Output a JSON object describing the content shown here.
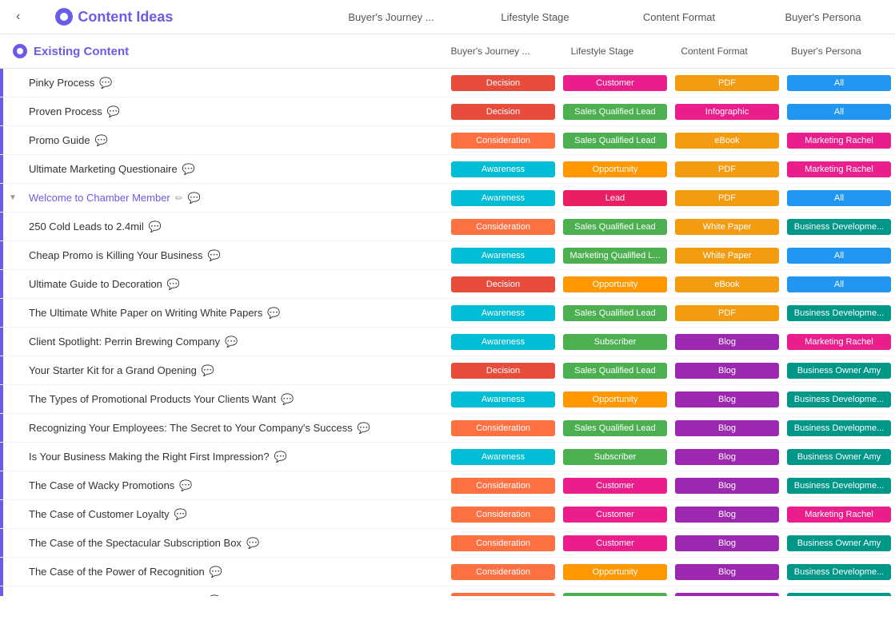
{
  "app": {
    "title": "Content Ideas",
    "back_arrow": "‹"
  },
  "nav": {
    "logo_text": "Content Ideas",
    "columns": [
      {
        "label": "Buyer's Journey ..."
      },
      {
        "label": "Lifestyle Stage"
      },
      {
        "label": "Content Format"
      },
      {
        "label": "Buyer's Persona"
      }
    ]
  },
  "section": {
    "title": "Existing Content",
    "col_headers": [
      {
        "label": "Buyer's Journey ..."
      },
      {
        "label": "Lifestyle Stage"
      },
      {
        "label": "Content Format"
      },
      {
        "label": "Buyer's Persona"
      }
    ]
  },
  "rows": [
    {
      "title": "Pinky Process",
      "is_link": false,
      "has_edit": false,
      "toggle": "",
      "cells": [
        {
          "text": "Decision",
          "color": "#e74c3c"
        },
        {
          "text": "Customer",
          "color": "#e91e8c"
        },
        {
          "text": "PDF",
          "color": "#f39c12"
        },
        {
          "text": "All",
          "color": "#2196f3"
        }
      ]
    },
    {
      "title": "Proven Process",
      "is_link": false,
      "has_edit": false,
      "toggle": "",
      "cells": [
        {
          "text": "Decision",
          "color": "#e74c3c"
        },
        {
          "text": "Sales Qualified Lead",
          "color": "#4caf50"
        },
        {
          "text": "Infographic",
          "color": "#e91e8c"
        },
        {
          "text": "All",
          "color": "#2196f3"
        }
      ]
    },
    {
      "title": "Promo Guide",
      "is_link": false,
      "has_edit": false,
      "toggle": "",
      "cells": [
        {
          "text": "Consideration",
          "color": "#ff7043"
        },
        {
          "text": "Sales Qualified Lead",
          "color": "#4caf50"
        },
        {
          "text": "eBook",
          "color": "#f39c12"
        },
        {
          "text": "Marketing Rachel",
          "color": "#e91e8c"
        }
      ]
    },
    {
      "title": "Ultimate Marketing Questionaire",
      "is_link": false,
      "has_edit": false,
      "toggle": "",
      "cells": [
        {
          "text": "Awareness",
          "color": "#00bcd4"
        },
        {
          "text": "Opportunity",
          "color": "#ff9800"
        },
        {
          "text": "PDF",
          "color": "#f39c12"
        },
        {
          "text": "Marketing Rachel",
          "color": "#e91e8c"
        }
      ]
    },
    {
      "title": "Welcome to Chamber Member",
      "is_link": true,
      "has_edit": true,
      "toggle": "▼",
      "cells": [
        {
          "text": "Awareness",
          "color": "#00bcd4"
        },
        {
          "text": "Lead",
          "color": "#e91e63"
        },
        {
          "text": "PDF",
          "color": "#f39c12"
        },
        {
          "text": "All",
          "color": "#2196f3"
        }
      ]
    },
    {
      "title": "250 Cold Leads to 2.4mil",
      "is_link": false,
      "has_edit": false,
      "toggle": "",
      "cells": [
        {
          "text": "Consideration",
          "color": "#ff7043"
        },
        {
          "text": "Sales Qualified Lead",
          "color": "#4caf50"
        },
        {
          "text": "White Paper",
          "color": "#f39c12"
        },
        {
          "text": "Business Developme...",
          "color": "#009688"
        }
      ]
    },
    {
      "title": "Cheap Promo is Killing Your Business",
      "is_link": false,
      "has_edit": false,
      "toggle": "",
      "cells": [
        {
          "text": "Awareness",
          "color": "#00bcd4"
        },
        {
          "text": "Marketing Qualified L...",
          "color": "#4caf50"
        },
        {
          "text": "White Paper",
          "color": "#f39c12"
        },
        {
          "text": "All",
          "color": "#2196f3"
        }
      ]
    },
    {
      "title": "Ultimate Guide to Decoration",
      "is_link": false,
      "has_edit": false,
      "toggle": "",
      "cells": [
        {
          "text": "Decision",
          "color": "#e74c3c"
        },
        {
          "text": "Opportunity",
          "color": "#ff9800"
        },
        {
          "text": "eBook",
          "color": "#f39c12"
        },
        {
          "text": "All",
          "color": "#2196f3"
        }
      ]
    },
    {
      "title": "The Ultimate White Paper on Writing White Papers",
      "is_link": false,
      "has_edit": false,
      "toggle": "",
      "cells": [
        {
          "text": "Awareness",
          "color": "#00bcd4"
        },
        {
          "text": "Sales Qualified Lead",
          "color": "#4caf50"
        },
        {
          "text": "PDF",
          "color": "#f39c12"
        },
        {
          "text": "Business Developme...",
          "color": "#009688"
        }
      ]
    },
    {
      "title": "Client Spotlight: Perrin Brewing Company",
      "is_link": false,
      "has_edit": false,
      "toggle": "",
      "cells": [
        {
          "text": "Awareness",
          "color": "#00bcd4"
        },
        {
          "text": "Subscriber",
          "color": "#4caf50"
        },
        {
          "text": "Blog",
          "color": "#9c27b0"
        },
        {
          "text": "Marketing Rachel",
          "color": "#e91e8c"
        }
      ]
    },
    {
      "title": "Your Starter Kit for a Grand Opening",
      "is_link": false,
      "has_edit": false,
      "toggle": "",
      "cells": [
        {
          "text": "Decision",
          "color": "#e74c3c"
        },
        {
          "text": "Sales Qualified Lead",
          "color": "#4caf50"
        },
        {
          "text": "Blog",
          "color": "#9c27b0"
        },
        {
          "text": "Business Owner Amy",
          "color": "#009688"
        }
      ]
    },
    {
      "title": "The Types of Promotional Products Your Clients Want",
      "is_link": false,
      "has_edit": false,
      "toggle": "",
      "cells": [
        {
          "text": "Awareness",
          "color": "#00bcd4"
        },
        {
          "text": "Opportunity",
          "color": "#ff9800"
        },
        {
          "text": "Blog",
          "color": "#9c27b0"
        },
        {
          "text": "Business Developme...",
          "color": "#009688"
        }
      ]
    },
    {
      "title": "Recognizing Your Employees: The Secret to Your Company's Success",
      "is_link": false,
      "has_edit": false,
      "toggle": "",
      "cells": [
        {
          "text": "Consideration",
          "color": "#ff7043"
        },
        {
          "text": "Sales Qualified Lead",
          "color": "#4caf50"
        },
        {
          "text": "Blog",
          "color": "#9c27b0"
        },
        {
          "text": "Business Developme...",
          "color": "#009688"
        }
      ]
    },
    {
      "title": "Is Your Business Making the Right First Impression?",
      "is_link": false,
      "has_edit": false,
      "toggle": "",
      "cells": [
        {
          "text": "Awareness",
          "color": "#00bcd4"
        },
        {
          "text": "Subscriber",
          "color": "#4caf50"
        },
        {
          "text": "Blog",
          "color": "#9c27b0"
        },
        {
          "text": "Business Owner Amy",
          "color": "#009688"
        }
      ]
    },
    {
      "title": "The Case of Wacky Promotions",
      "is_link": false,
      "has_edit": false,
      "toggle": "",
      "cells": [
        {
          "text": "Consideration",
          "color": "#ff7043"
        },
        {
          "text": "Customer",
          "color": "#e91e8c"
        },
        {
          "text": "Blog",
          "color": "#9c27b0"
        },
        {
          "text": "Business Developme...",
          "color": "#009688"
        }
      ]
    },
    {
      "title": "The Case of Customer Loyalty",
      "is_link": false,
      "has_edit": false,
      "toggle": "",
      "cells": [
        {
          "text": "Consideration",
          "color": "#ff7043"
        },
        {
          "text": "Customer",
          "color": "#e91e8c"
        },
        {
          "text": "Blog",
          "color": "#9c27b0"
        },
        {
          "text": "Marketing Rachel",
          "color": "#e91e8c"
        }
      ]
    },
    {
      "title": "The Case of the Spectacular Subscription Box",
      "is_link": false,
      "has_edit": false,
      "toggle": "",
      "cells": [
        {
          "text": "Consideration",
          "color": "#ff7043"
        },
        {
          "text": "Customer",
          "color": "#e91e8c"
        },
        {
          "text": "Blog",
          "color": "#9c27b0"
        },
        {
          "text": "Business Owner Amy",
          "color": "#009688"
        }
      ]
    },
    {
      "title": "The Case of the Power of Recognition",
      "is_link": false,
      "has_edit": false,
      "toggle": "",
      "cells": [
        {
          "text": "Consideration",
          "color": "#ff7043"
        },
        {
          "text": "Opportunity",
          "color": "#ff9800"
        },
        {
          "text": "Blog",
          "color": "#9c27b0"
        },
        {
          "text": "Business Developme...",
          "color": "#009688"
        }
      ]
    },
    {
      "title": "The Case of Getting Customer-Ready",
      "is_link": false,
      "has_edit": false,
      "toggle": "",
      "cells": [
        {
          "text": "Consideration",
          "color": "#ff7043"
        },
        {
          "text": "Marketing Qualified L...",
          "color": "#4caf50"
        },
        {
          "text": "Blog",
          "color": "#9c27b0"
        },
        {
          "text": "Business Developme...",
          "color": "#009688"
        }
      ]
    }
  ]
}
